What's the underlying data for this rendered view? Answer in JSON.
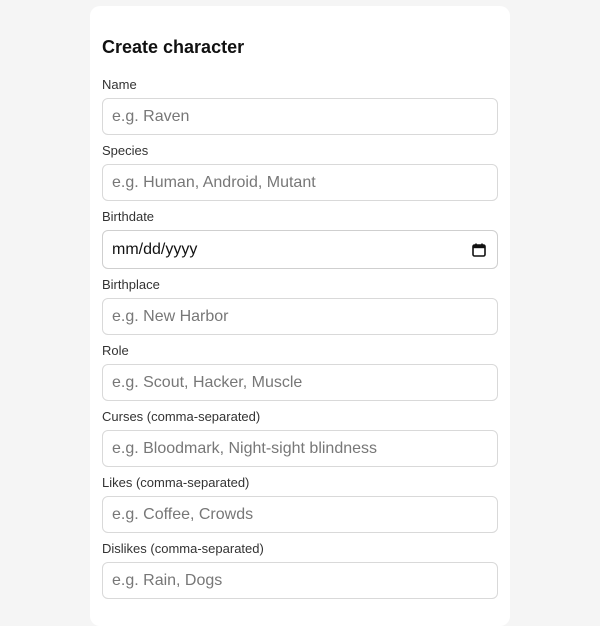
{
  "form": {
    "title": "Create character",
    "fields": [
      {
        "label": "Name",
        "placeholder": "e.g. Raven"
      },
      {
        "label": "Species",
        "placeholder": "e.g. Human, Android, Mutant"
      },
      {
        "label": "Birthdate",
        "value": "mm/dd/yyyy"
      },
      {
        "label": "Birthplace",
        "placeholder": "e.g. New Harbor"
      },
      {
        "label": "Role",
        "placeholder": "e.g. Scout, Hacker, Muscle"
      },
      {
        "label": "Curses (comma-separated)",
        "placeholder": "e.g. Bloodmark, Night-sight blindness"
      },
      {
        "label": "Likes (comma-separated)",
        "placeholder": "e.g. Coffee, Crowds"
      },
      {
        "label": "Dislikes (comma-separated)",
        "placeholder": "e.g. Rain, Dogs"
      }
    ]
  },
  "icons": {
    "date_picker": "calendar-icon"
  }
}
